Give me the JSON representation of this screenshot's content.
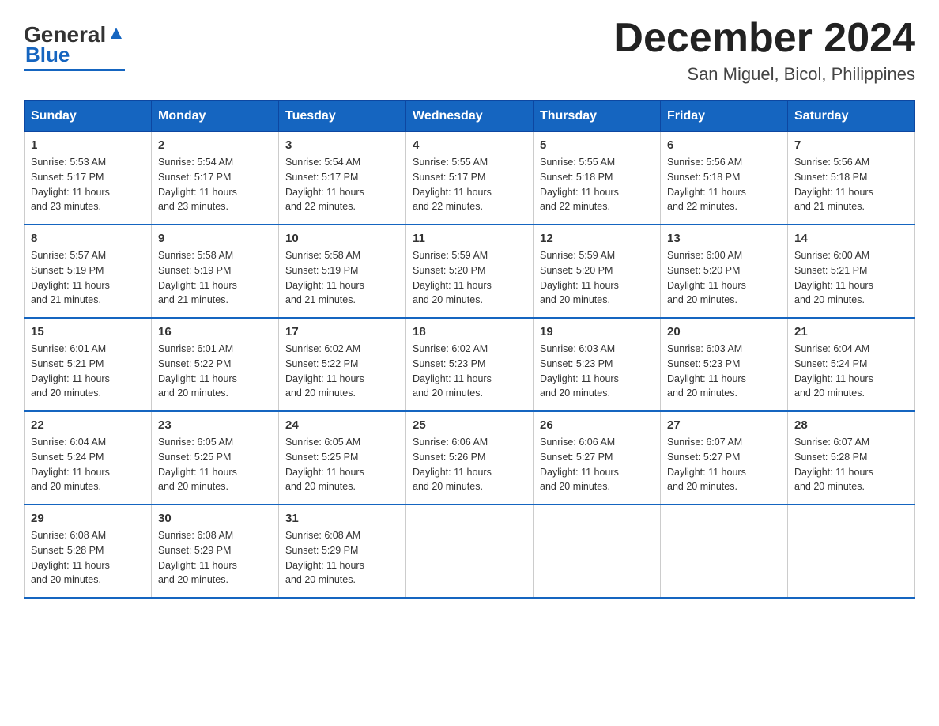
{
  "logo": {
    "text_general": "General",
    "text_blue": "Blue"
  },
  "title": "December 2024",
  "location": "San Miguel, Bicol, Philippines",
  "days_of_week": [
    "Sunday",
    "Monday",
    "Tuesday",
    "Wednesday",
    "Thursday",
    "Friday",
    "Saturday"
  ],
  "weeks": [
    [
      {
        "day": "1",
        "sunrise": "5:53 AM",
        "sunset": "5:17 PM",
        "daylight": "11 hours and 23 minutes."
      },
      {
        "day": "2",
        "sunrise": "5:54 AM",
        "sunset": "5:17 PM",
        "daylight": "11 hours and 23 minutes."
      },
      {
        "day": "3",
        "sunrise": "5:54 AM",
        "sunset": "5:17 PM",
        "daylight": "11 hours and 22 minutes."
      },
      {
        "day": "4",
        "sunrise": "5:55 AM",
        "sunset": "5:17 PM",
        "daylight": "11 hours and 22 minutes."
      },
      {
        "day": "5",
        "sunrise": "5:55 AM",
        "sunset": "5:18 PM",
        "daylight": "11 hours and 22 minutes."
      },
      {
        "day": "6",
        "sunrise": "5:56 AM",
        "sunset": "5:18 PM",
        "daylight": "11 hours and 22 minutes."
      },
      {
        "day": "7",
        "sunrise": "5:56 AM",
        "sunset": "5:18 PM",
        "daylight": "11 hours and 21 minutes."
      }
    ],
    [
      {
        "day": "8",
        "sunrise": "5:57 AM",
        "sunset": "5:19 PM",
        "daylight": "11 hours and 21 minutes."
      },
      {
        "day": "9",
        "sunrise": "5:58 AM",
        "sunset": "5:19 PM",
        "daylight": "11 hours and 21 minutes."
      },
      {
        "day": "10",
        "sunrise": "5:58 AM",
        "sunset": "5:19 PM",
        "daylight": "11 hours and 21 minutes."
      },
      {
        "day": "11",
        "sunrise": "5:59 AM",
        "sunset": "5:20 PM",
        "daylight": "11 hours and 20 minutes."
      },
      {
        "day": "12",
        "sunrise": "5:59 AM",
        "sunset": "5:20 PM",
        "daylight": "11 hours and 20 minutes."
      },
      {
        "day": "13",
        "sunrise": "6:00 AM",
        "sunset": "5:20 PM",
        "daylight": "11 hours and 20 minutes."
      },
      {
        "day": "14",
        "sunrise": "6:00 AM",
        "sunset": "5:21 PM",
        "daylight": "11 hours and 20 minutes."
      }
    ],
    [
      {
        "day": "15",
        "sunrise": "6:01 AM",
        "sunset": "5:21 PM",
        "daylight": "11 hours and 20 minutes."
      },
      {
        "day": "16",
        "sunrise": "6:01 AM",
        "sunset": "5:22 PM",
        "daylight": "11 hours and 20 minutes."
      },
      {
        "day": "17",
        "sunrise": "6:02 AM",
        "sunset": "5:22 PM",
        "daylight": "11 hours and 20 minutes."
      },
      {
        "day": "18",
        "sunrise": "6:02 AM",
        "sunset": "5:23 PM",
        "daylight": "11 hours and 20 minutes."
      },
      {
        "day": "19",
        "sunrise": "6:03 AM",
        "sunset": "5:23 PM",
        "daylight": "11 hours and 20 minutes."
      },
      {
        "day": "20",
        "sunrise": "6:03 AM",
        "sunset": "5:23 PM",
        "daylight": "11 hours and 20 minutes."
      },
      {
        "day": "21",
        "sunrise": "6:04 AM",
        "sunset": "5:24 PM",
        "daylight": "11 hours and 20 minutes."
      }
    ],
    [
      {
        "day": "22",
        "sunrise": "6:04 AM",
        "sunset": "5:24 PM",
        "daylight": "11 hours and 20 minutes."
      },
      {
        "day": "23",
        "sunrise": "6:05 AM",
        "sunset": "5:25 PM",
        "daylight": "11 hours and 20 minutes."
      },
      {
        "day": "24",
        "sunrise": "6:05 AM",
        "sunset": "5:25 PM",
        "daylight": "11 hours and 20 minutes."
      },
      {
        "day": "25",
        "sunrise": "6:06 AM",
        "sunset": "5:26 PM",
        "daylight": "11 hours and 20 minutes."
      },
      {
        "day": "26",
        "sunrise": "6:06 AM",
        "sunset": "5:27 PM",
        "daylight": "11 hours and 20 minutes."
      },
      {
        "day": "27",
        "sunrise": "6:07 AM",
        "sunset": "5:27 PM",
        "daylight": "11 hours and 20 minutes."
      },
      {
        "day": "28",
        "sunrise": "6:07 AM",
        "sunset": "5:28 PM",
        "daylight": "11 hours and 20 minutes."
      }
    ],
    [
      {
        "day": "29",
        "sunrise": "6:08 AM",
        "sunset": "5:28 PM",
        "daylight": "11 hours and 20 minutes."
      },
      {
        "day": "30",
        "sunrise": "6:08 AM",
        "sunset": "5:29 PM",
        "daylight": "11 hours and 20 minutes."
      },
      {
        "day": "31",
        "sunrise": "6:08 AM",
        "sunset": "5:29 PM",
        "daylight": "11 hours and 20 minutes."
      },
      null,
      null,
      null,
      null
    ]
  ],
  "labels": {
    "sunrise": "Sunrise:",
    "sunset": "Sunset:",
    "daylight": "Daylight:"
  }
}
